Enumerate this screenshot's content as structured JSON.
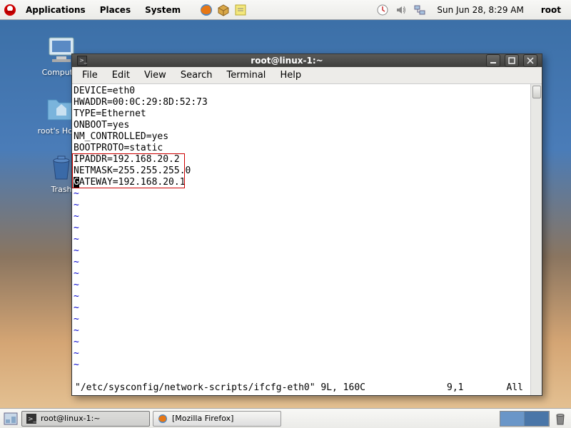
{
  "panel": {
    "menus": [
      "Applications",
      "Places",
      "System"
    ],
    "datetime": "Sun Jun 28,  8:29 AM",
    "user": "root"
  },
  "desktop_icons": {
    "computer": "Computer",
    "home": "root's Home",
    "trash": "Trash"
  },
  "window": {
    "title": "root@linux-1:~",
    "menus": [
      "File",
      "Edit",
      "View",
      "Search",
      "Terminal",
      "Help"
    ]
  },
  "terminal": {
    "lines": [
      "DEVICE=eth0",
      "HWADDR=00:0C:29:8D:52:73",
      "TYPE=Ethernet",
      "ONBOOT=yes",
      "NM_CONTROLLED=yes",
      "BOOTPROTO=static",
      "IPADDR=192.168.20.2",
      "NETMASK=255.255.255.0"
    ],
    "cursor_prefix": "G",
    "cursor_rest": "ATEWAY=192.168.20.1",
    "status_file": "\"/etc/sysconfig/network-scripts/ifcfg-eth0\" 9L, 160C",
    "status_pos": "9,1",
    "status_all": "All"
  },
  "taskbar": {
    "item1": "root@linux-1:~",
    "item2": "[Mozilla Firefox]"
  }
}
